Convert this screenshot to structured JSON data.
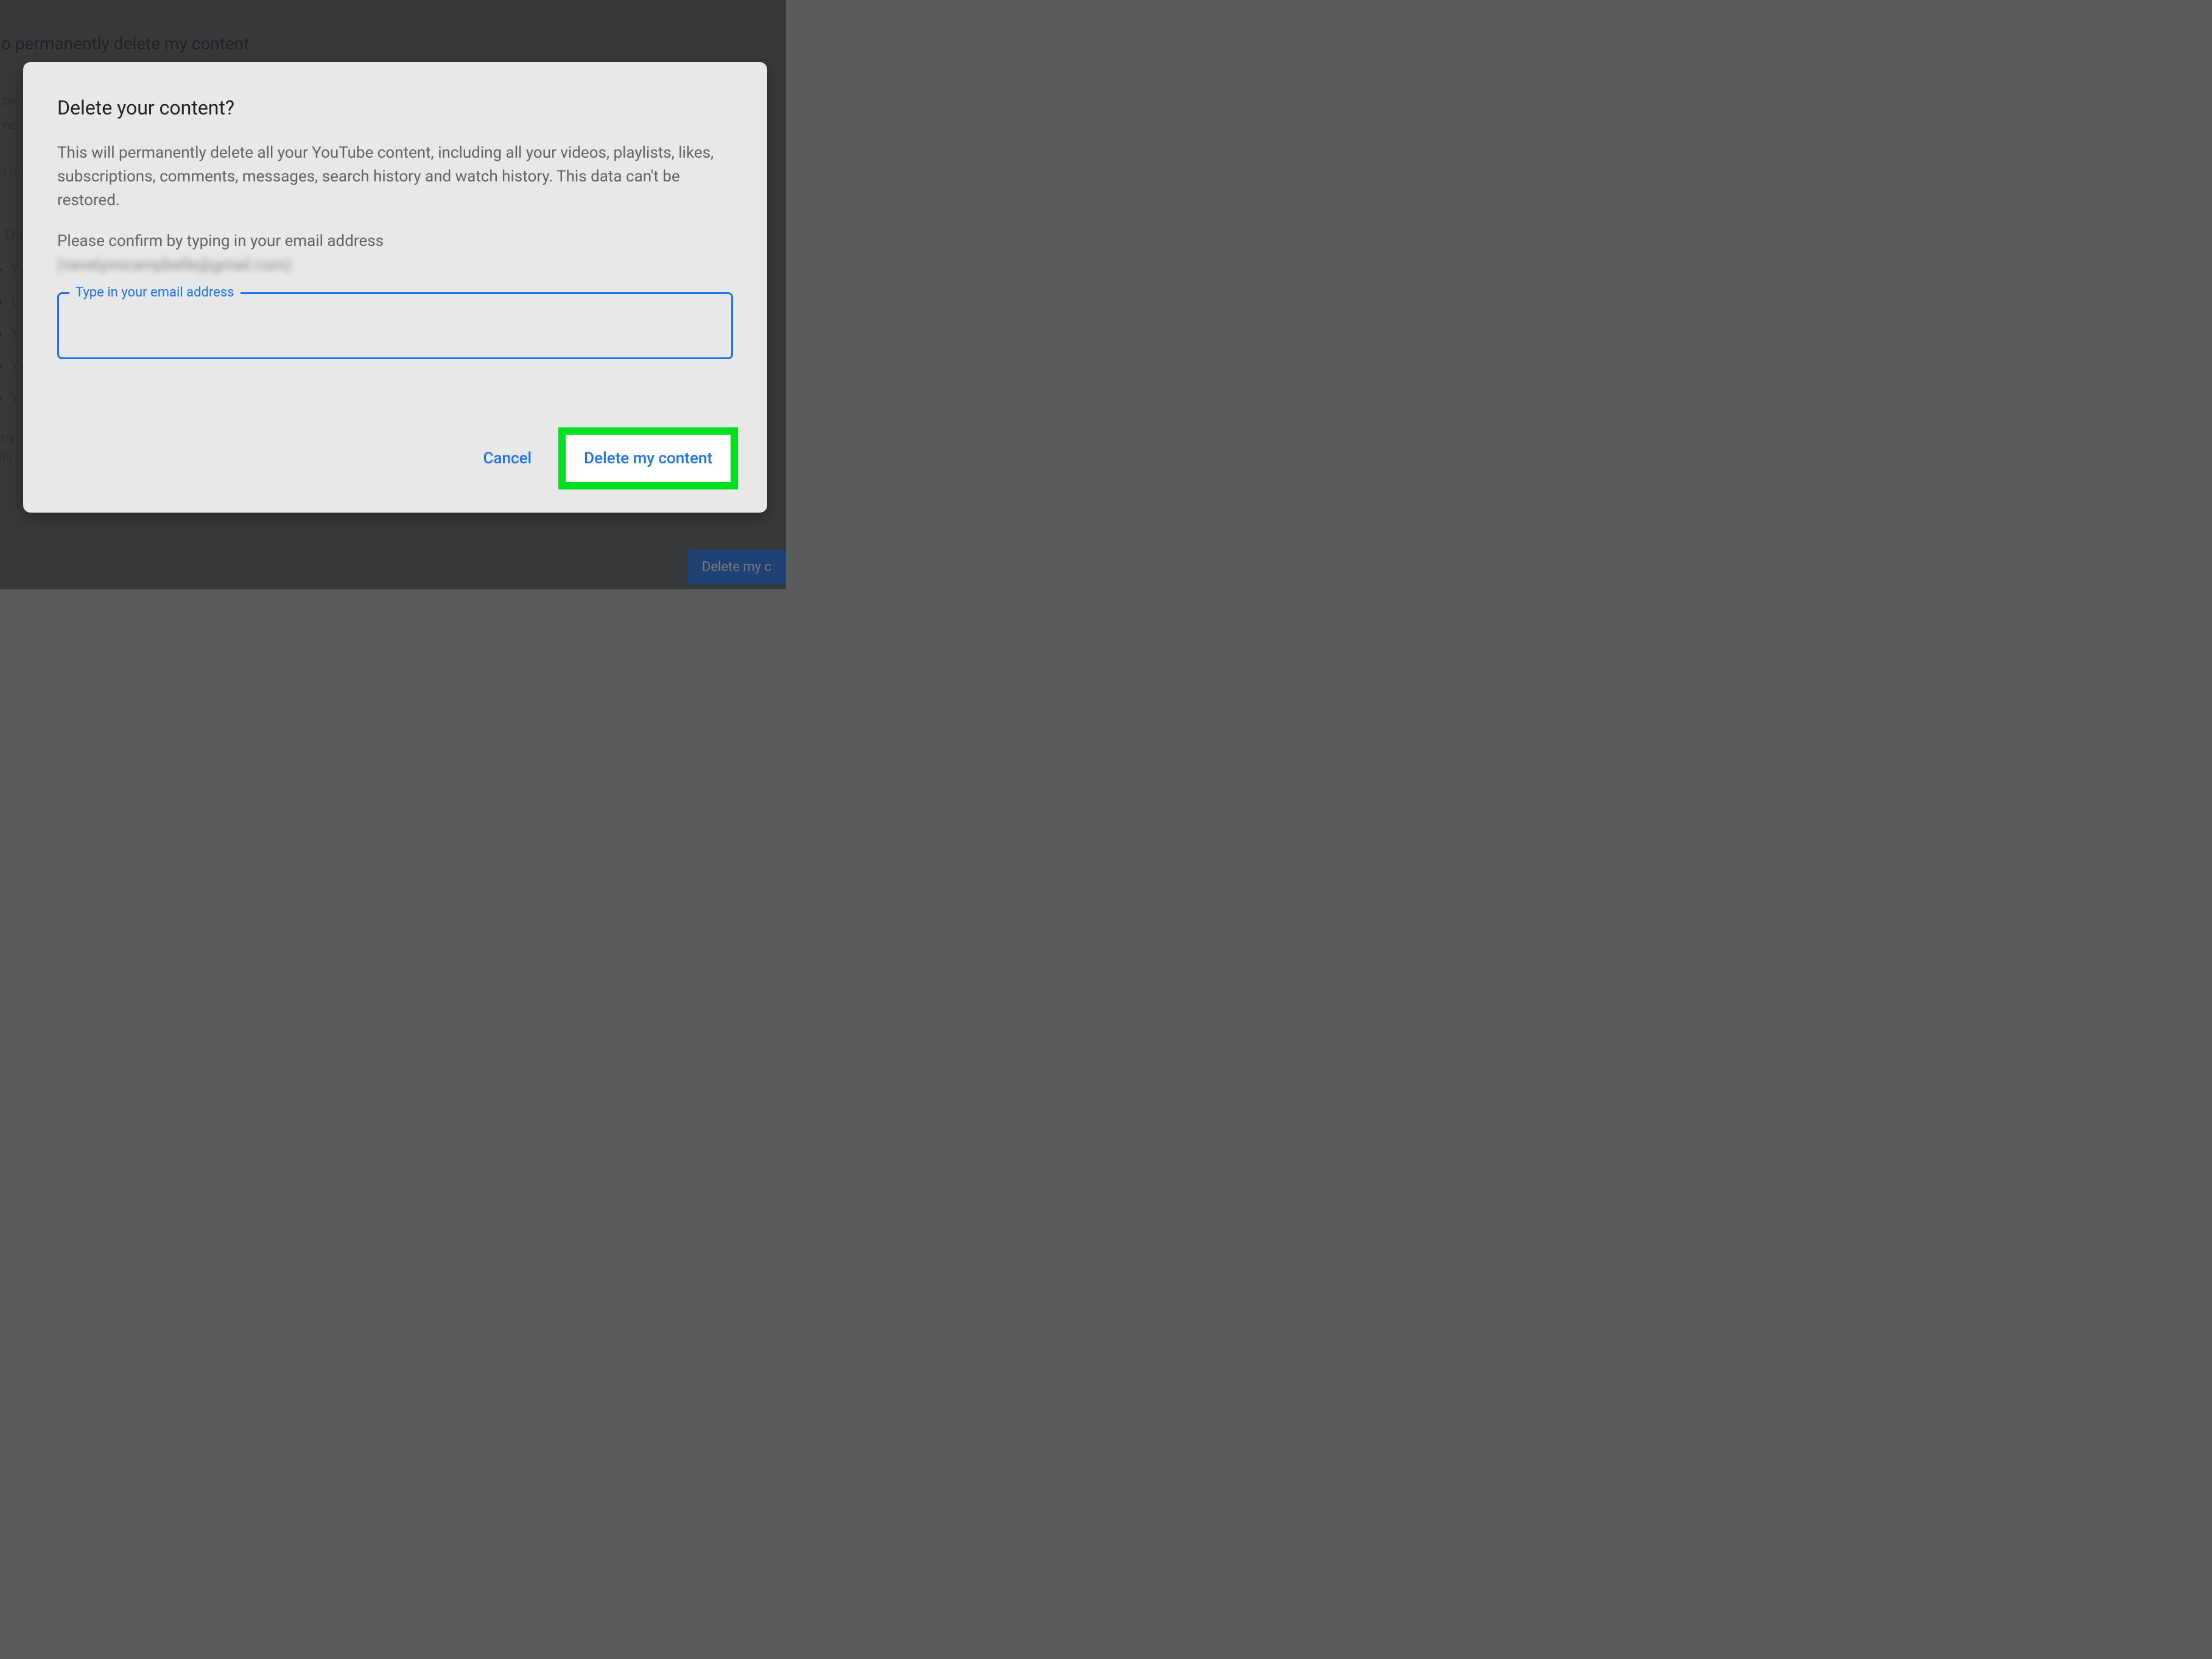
{
  "background": {
    "heading": "o permanently delete my content",
    "text_pe": "pe",
    "text_nc": "nc",
    "text_lo": "l o",
    "text_the": "The",
    "text_any": "Any",
    "text_will": "will",
    "list_y": "Y",
    "list_c": "C",
    "button_label": "Delete my c"
  },
  "dialog": {
    "title": "Delete your content?",
    "body": "This will permanently delete all your YouTube content, including all your videos, playlists, likes, subscriptions, comments, messages, search history and watch history. This data can't be restored.",
    "confirm_text": "Please confirm by typing in your email address",
    "blurred_email": "(nevelynncampbelle@gmail.com)",
    "input_label": "Type in your email address",
    "input_value": "",
    "cancel_label": "Cancel",
    "delete_label": "Delete my content"
  }
}
